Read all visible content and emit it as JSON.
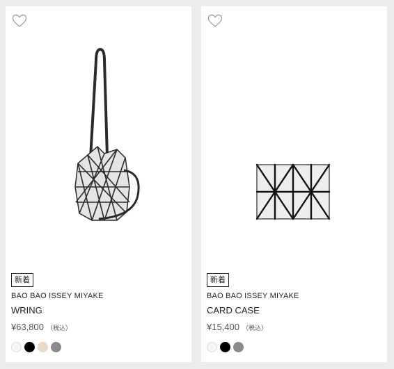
{
  "products": [
    {
      "badge": "新着",
      "brand": "BAO BAO ISSEY MIYAKE",
      "name": "WRING",
      "price": "¥63,800",
      "tax": "（税込）",
      "image_icon": "bucket-bag-icon",
      "swatches": [
        "#f5f5f5",
        "#000000",
        "#e6d9cc",
        "#8a8a8a"
      ]
    },
    {
      "badge": "新着",
      "brand": "BAO BAO ISSEY MIYAKE",
      "name": "CARD CASE",
      "price": "¥15,400",
      "tax": "（税込）",
      "image_icon": "card-case-icon",
      "swatches": [
        "#f5f5f5",
        "#000000",
        "#8a8a8a"
      ]
    }
  ]
}
